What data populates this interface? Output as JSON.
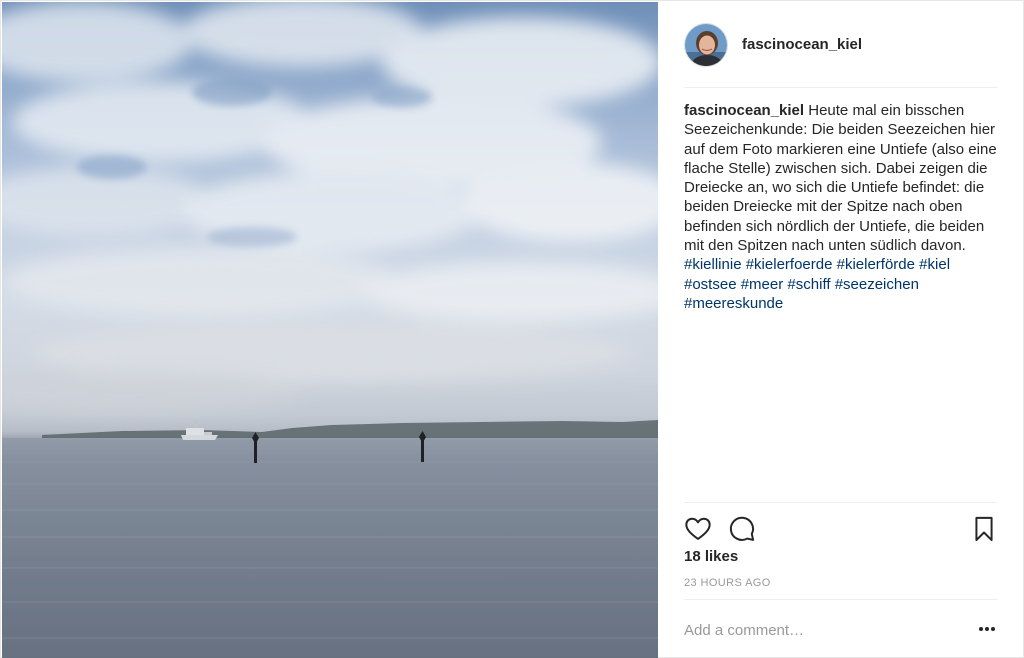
{
  "post": {
    "username": "fascinocean_kiel",
    "caption": {
      "username": "fascinocean_kiel",
      "text": "Heute mal ein bisschen Seezeichenkunde: Die beiden Seezeichen hier auf dem Foto markieren eine Untiefe (also eine flache Stelle) zwischen sich. Dabei zeigen die Dreiecke an, wo sich die Untiefe befindet: die beiden Dreiecke mit der Spitze nach oben befinden sich nördlich der Untiefe, die beiden mit den Spitzen nach unten südlich davon.",
      "hashtags": [
        "#kiellinie",
        "#kielerfoerde",
        "#kielerförde",
        "#kiel",
        "#ostsee",
        "#meer",
        "#schiff",
        "#seezeichen",
        "#meereskunde"
      ]
    },
    "likes": "18 likes",
    "time": "23 HOURS AGO",
    "comment_placeholder": "Add a comment…"
  },
  "icons": {
    "like": "heart-icon",
    "comment": "comment-bubble-icon",
    "save": "bookmark-icon",
    "more": "more-options-icon"
  },
  "colors": {
    "text": "#262626",
    "hashtag": "#003569",
    "muted": "#999999",
    "divider": "#efefef"
  }
}
